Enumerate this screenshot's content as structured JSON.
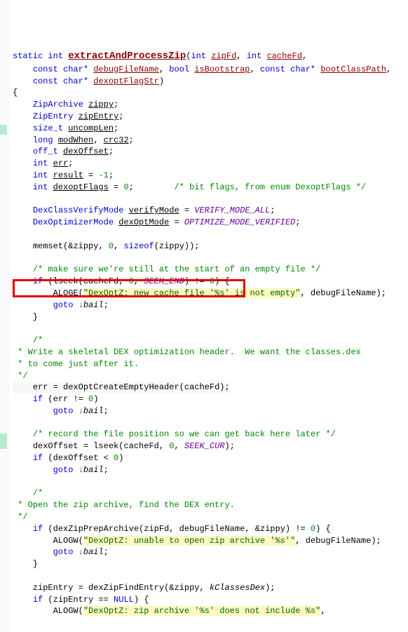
{
  "code": {
    "sig_kw_static": "static",
    "sig_kw_int": "int",
    "fn_name": "extractAndProcessZip",
    "p1_type": "int",
    "p1_name": "zipFd",
    "p2_type": "int",
    "p2_name": "cacheFd",
    "p3_type": "const char*",
    "p3_name": "debugFileName",
    "p4_type": "bool",
    "p4_name": "isBootstrap",
    "p5_type": "const char*",
    "p5_name": "bootClassPath",
    "p6_type": "const char*",
    "p6_name": "dexoptFlagStr",
    "open_brace": "{",
    "d1_type": "ZipArchive",
    "d1_name": "zippy",
    "d2_type": "ZipEntry",
    "d2_name": "zipEntry",
    "d3_type": "size_t",
    "d3_name": "uncompLen",
    "d4_type": "long",
    "d4_name_a": "modWhen",
    "d4_name_b": "crc32",
    "d5_type": "off_t",
    "d5_name": "dexOffset",
    "d6_type": "int",
    "d6_name": "err",
    "d7_type": "int",
    "d7_name": "result",
    "d7_val": "-1",
    "d8_type": "int",
    "d8_name": "dexoptFlags",
    "d8_val": "0",
    "d8_comment": "/* bit flags, from enum DexoptFlags */",
    "vm_type": "DexClassVerifyMode",
    "vm_name": "verifyMode",
    "vm_val": "VERIFY_MODE_ALL",
    "om_type": "DexOptimizerMode",
    "om_name": "dexOptMode",
    "om_val": "OPTIMIZE_MODE_VERIFIED",
    "memset_call": "memset",
    "memset_arg1": "&zippy",
    "memset_arg2": "0",
    "memset_sizeof": "sizeof",
    "memset_szarg": "zippy",
    "cmt1": "/* make sure we're still at the start of an empty file */",
    "if1_call": "lseek",
    "if1_arg2": "0",
    "if1_arg3": "SEEK_END",
    "if1_cmp": "0",
    "aloge": "ALOGE",
    "aloge_str": "\"DexOptZ: new cache file '%s' is not empty\"",
    "goto": "goto",
    "bail": "bail",
    "cmt2a": "/*",
    "cmt2b": " * Write a skeletal DEX optimization header.  We want the classes.dex",
    "cmt2c": " * to come just after it.",
    "cmt2d": " */",
    "hl_lhs": "err",
    "hl_call": "dexOptCreateEmptyHeader",
    "hl_arg": "cacheFd",
    "if_err_cmp": "0",
    "cmt3": "/* record the file position so we can get back here later */",
    "dexoff_lhs": "dexOffset",
    "dexoff_call": "lseek",
    "dexoff_arg2": "0",
    "dexoff_arg3": "SEEK_CUR",
    "if3_cmp": "0",
    "cmt4a": "/*",
    "cmt4b": " * Open the zip archive, find the DEX entry.",
    "cmt4c": " */",
    "if4_call": "dexZipPrepArchive",
    "if4_zippy": "&zippy",
    "if4_cmp": "0",
    "alogw": "ALOGW",
    "alogw_str1": "\"DexOptZ: unable to open zip archive '%s'\"",
    "ze_lhs": "zipEntry",
    "ze_call": "dexZipFindEntry",
    "ze_arg1": "&zippy",
    "ze_arg2": "kClassesDex",
    "if5_cmp": "NULL",
    "alogw_str2": "\"DexOptZ: zip archive '%s' does not include %s\""
  },
  "chart_data": null
}
